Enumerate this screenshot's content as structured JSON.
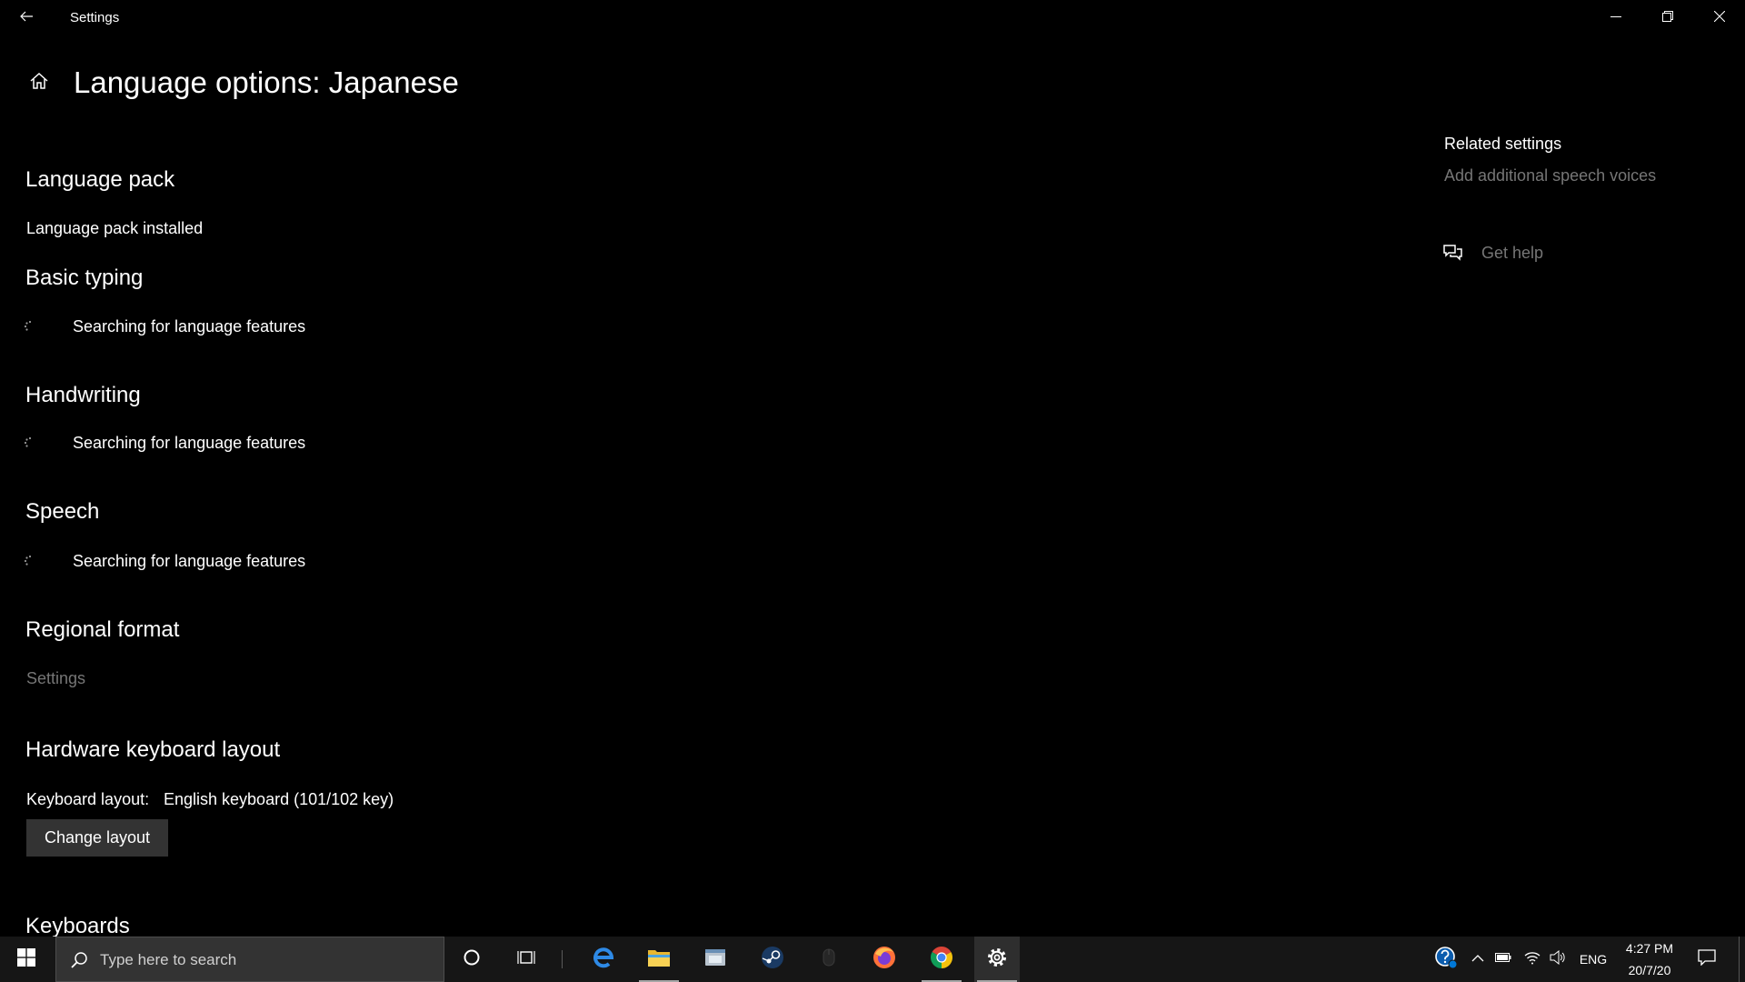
{
  "window": {
    "title": "Settings",
    "back_icon": "back-arrow-icon",
    "controls": {
      "minimize": "minimize-icon",
      "restore": "restore-icon",
      "close": "close-icon"
    }
  },
  "page": {
    "title": "Language options: Japanese",
    "home_icon": "home-icon"
  },
  "language_pack": {
    "heading": "Language pack",
    "status": "Language pack installed"
  },
  "basic_typing": {
    "heading": "Basic typing",
    "status": "Searching for language features"
  },
  "handwriting": {
    "heading": "Handwriting",
    "status": "Searching for language features"
  },
  "speech": {
    "heading": "Speech",
    "status": "Searching for language features"
  },
  "regional_format": {
    "heading": "Regional format",
    "link": "Settings"
  },
  "hardware_keyboard": {
    "heading": "Hardware keyboard layout",
    "label": "Keyboard layout:",
    "value": "English keyboard (101/102 key)",
    "button": "Change layout"
  },
  "keyboards": {
    "heading": "Keyboards"
  },
  "related": {
    "heading": "Related settings",
    "speech_voices_link": "Add additional speech voices",
    "get_help": "Get help",
    "get_help_icon": "chat-help-icon"
  },
  "taskbar": {
    "search_placeholder": "Type here to search",
    "pinned": [
      {
        "icon": "edge-icon",
        "running": false
      },
      {
        "icon": "file-explorer-icon",
        "running": true
      },
      {
        "icon": "app-window-icon",
        "running": false
      },
      {
        "icon": "steam-icon",
        "running": false
      },
      {
        "icon": "mouse-icon",
        "running": false
      },
      {
        "icon": "firefox-icon",
        "running": false
      },
      {
        "icon": "chrome-icon",
        "running": true
      },
      {
        "icon": "settings-gear-icon",
        "running": true,
        "active": true
      }
    ],
    "tray": {
      "language": "ENG",
      "time": "4:27 PM",
      "date": "20/7/20",
      "icons": [
        "help-icon",
        "chevron-up-icon",
        "battery-icon",
        "wifi-icon",
        "volume-icon",
        "notification-icon"
      ]
    }
  },
  "colors": {
    "background": "#000000",
    "text": "#ffffff",
    "disabled_text": "#767676",
    "button": "#333333",
    "taskbar": "#161616",
    "accent": "#0078d7"
  }
}
